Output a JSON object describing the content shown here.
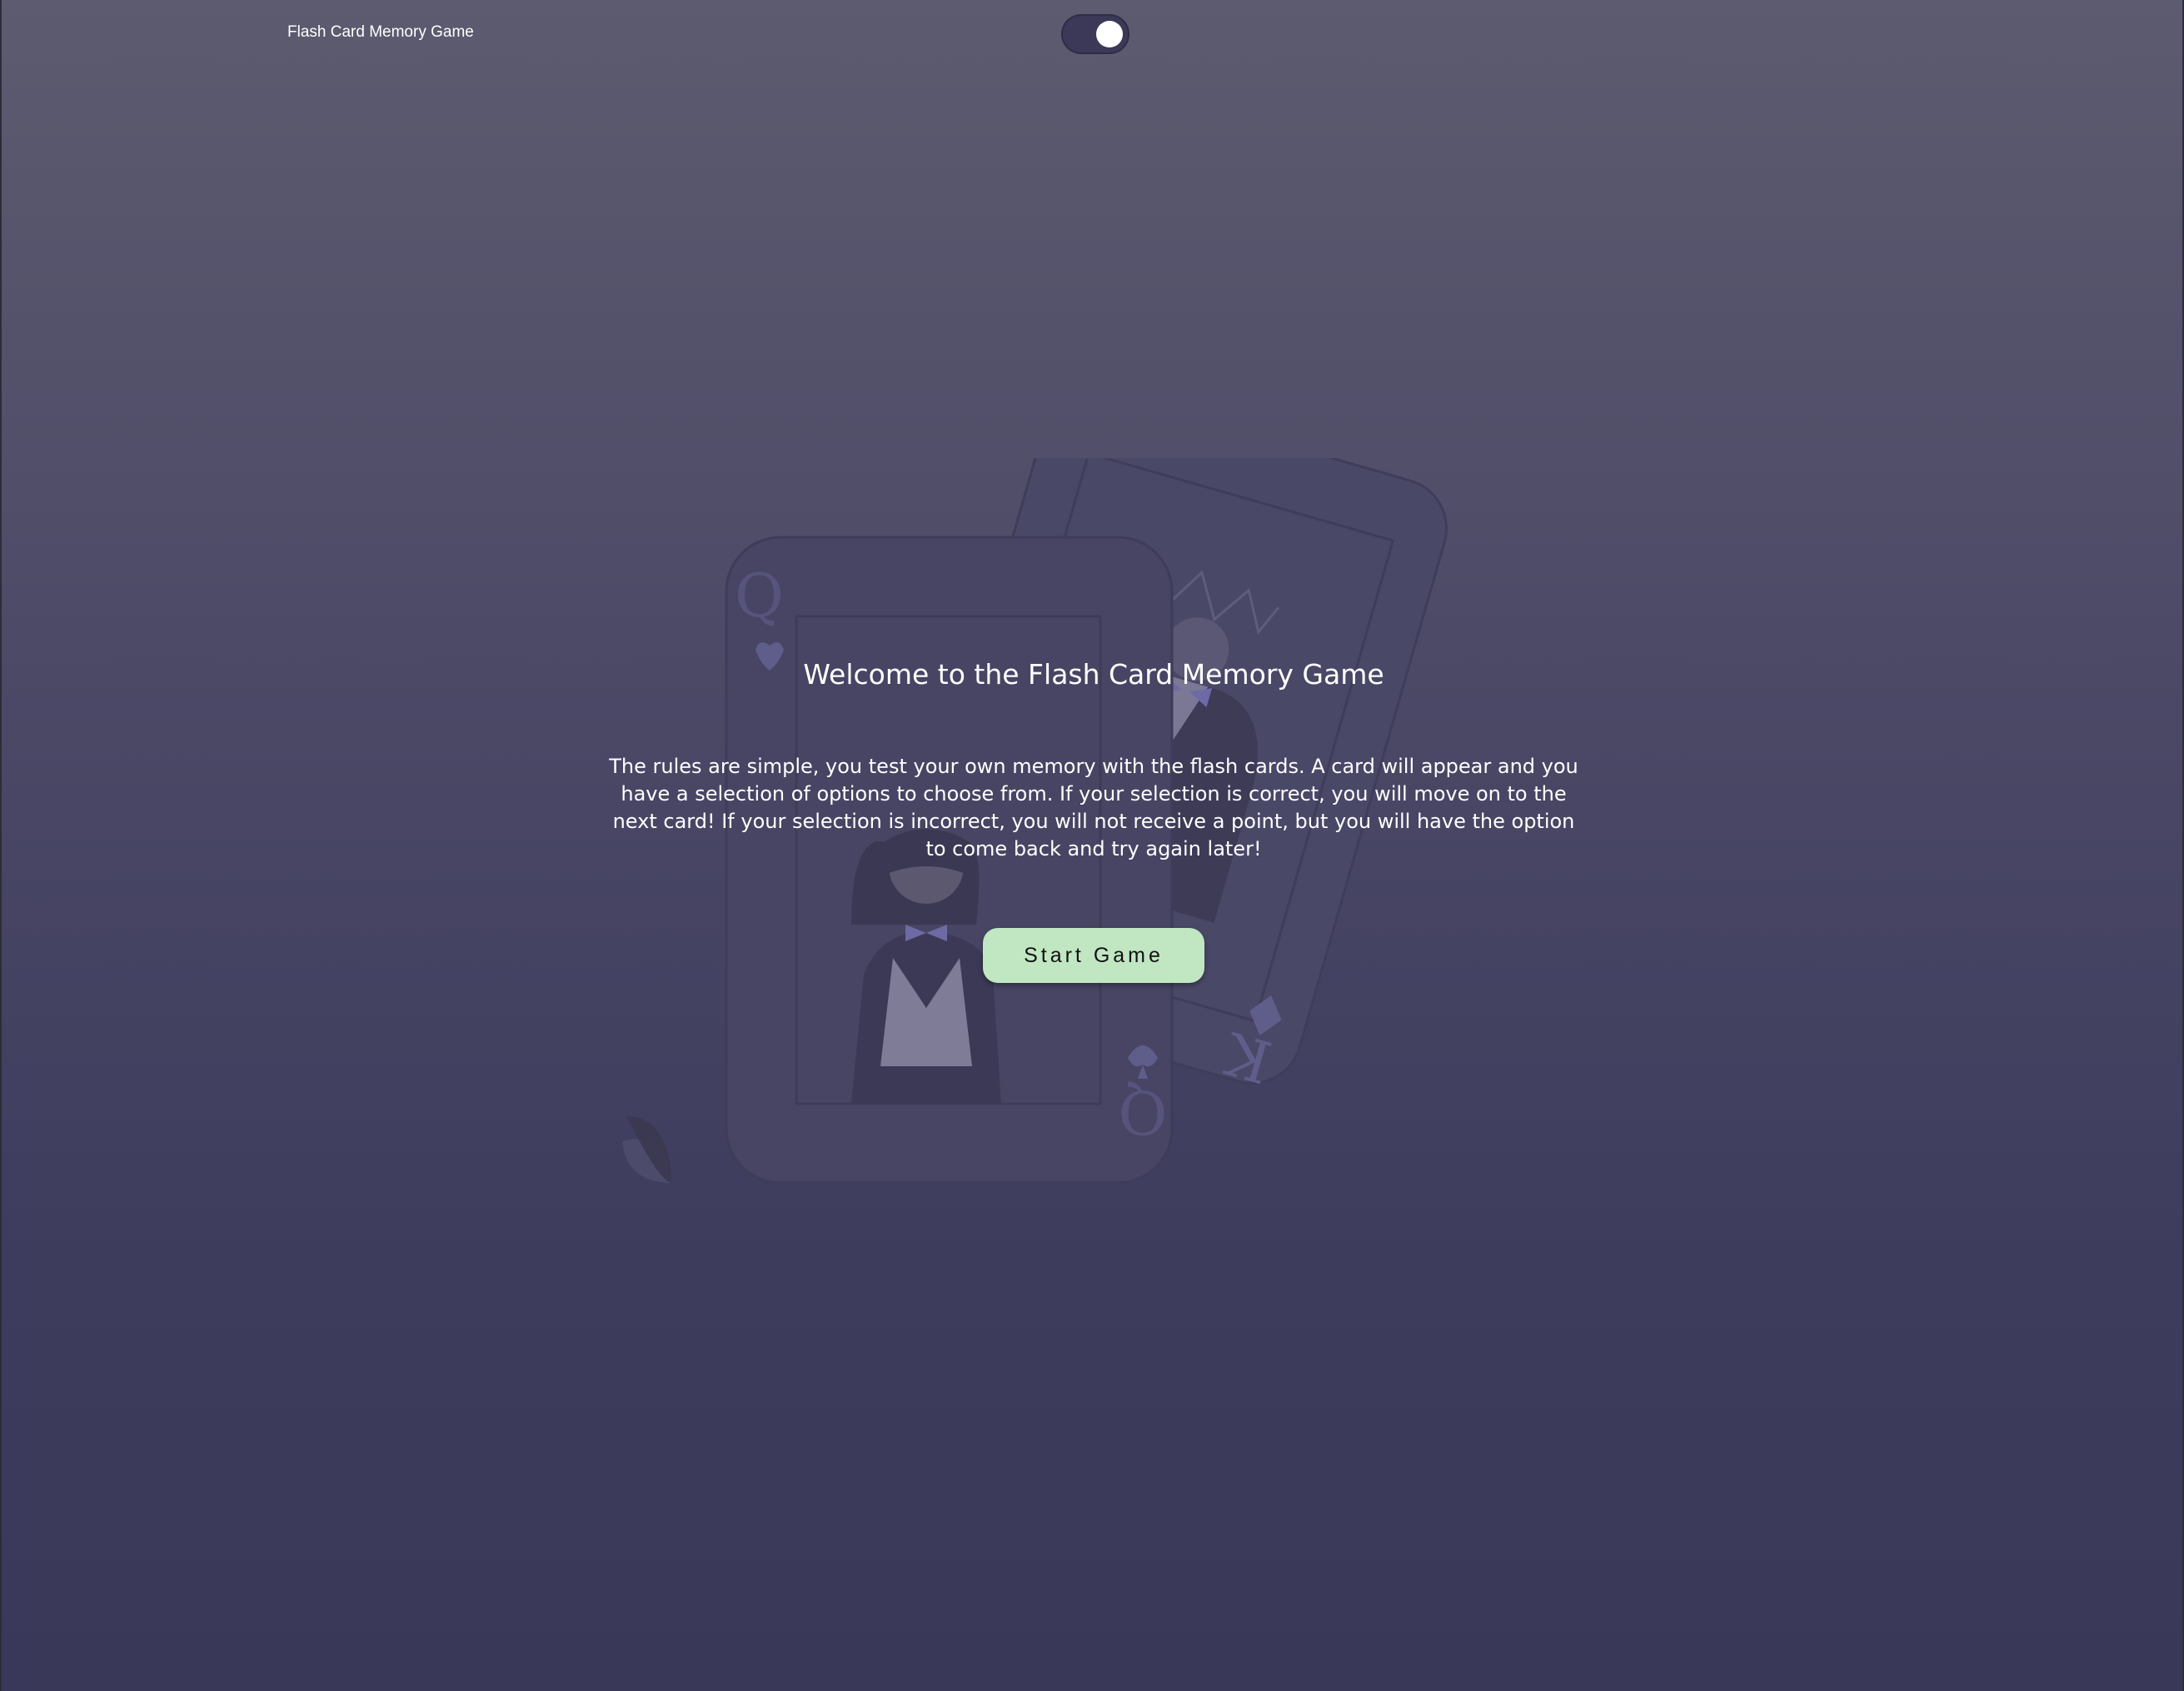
{
  "header": {
    "app_title": "Flash Card Memory Game",
    "theme_toggle_state": "on"
  },
  "main": {
    "title": "Welcome to the Flash Card Memory Game",
    "rules": "The rules are simple, you test your own memory with the flash cards. A card will appear and you have a selection of options to choose from. If your selection is correct, you will move on to the next card! If your selection is incorrect, you will not receive a point, but you will have the option to come back and try again later!",
    "start_button_label": "Start Game"
  },
  "illustration": {
    "queen_card_letter": "Q",
    "king_card_letter": "K"
  },
  "colors": {
    "background_top": "#5d5b6f",
    "background_bottom": "#3a3858",
    "button": "#c1e6c2",
    "text": "#ffffff"
  }
}
